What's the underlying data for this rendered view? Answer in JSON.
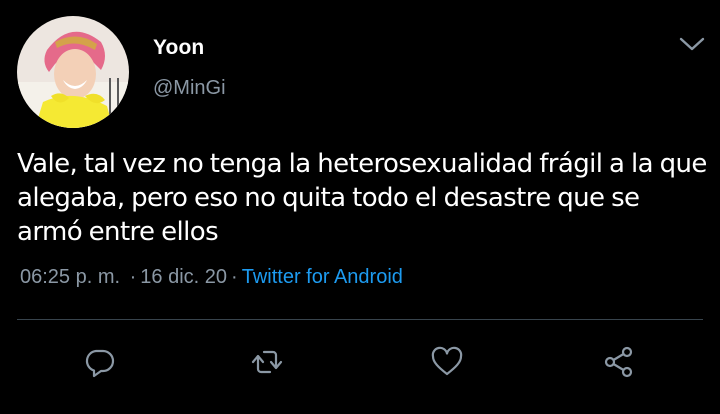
{
  "user": {
    "display_name": "Yoon",
    "handle": "@MinGi"
  },
  "tweet": {
    "text": "Vale, tal vez no tenga la heterosexualidad frágil a la que alegaba, pero eso no quita todo el desastre que se armó entre ellos",
    "time": "06:25 p. m.",
    "date": "16 dic. 20",
    "separator": "·",
    "source": "Twitter for Android"
  },
  "icons": {
    "menu": "chevron-down-icon",
    "reply": "reply-icon",
    "retweet": "retweet-icon",
    "like": "like-icon",
    "share": "share-icon"
  },
  "colors": {
    "background": "#000000",
    "text": "#ffffff",
    "secondary": "#8b98a5",
    "link": "#1d9bf0",
    "divider": "#38444d"
  }
}
